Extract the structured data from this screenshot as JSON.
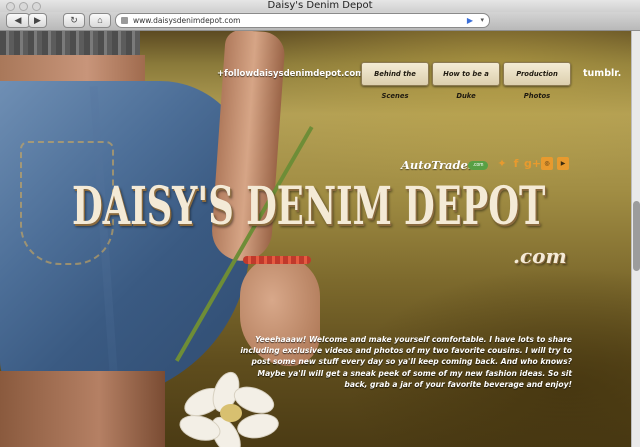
{
  "window": {
    "title": "Daisy's Denim Depot"
  },
  "toolbar": {
    "back_label": "◀",
    "forward_label": "▶",
    "reload_label": "↻",
    "home_label": "⌂",
    "address_value": "www.daisysdenimdepot.com",
    "go_label": "▶",
    "dropdown_label": "▾"
  },
  "nav": {
    "follow_link": "+followdaisysdenimdepot.com",
    "buttons": [
      "Behind the Scenes",
      "How to be a Duke",
      "Production Photos"
    ],
    "tumblr": "tumblr."
  },
  "sponsor": {
    "name": "AutoTrader",
    "badge": ".com"
  },
  "social_icons": [
    "twitter-icon",
    "facebook-icon",
    "google-plus-icon",
    "instagram-icon",
    "youtube-icon"
  ],
  "logo": {
    "main": "DAISY'S DENIM DEPOT",
    "suffix": ".com"
  },
  "intro": {
    "lead": "Yeeehaaaw!",
    "body": " Welcome and make yourself comfortable. I have lots to share including exclusive videos and photos of my two favorite cousins. I will try to post some new stuff every day so ya'll keep coming back. And who knows? Maybe ya'll will get a sneak peek of some of my new fashion ideas. So sit back, grab a jar of your favorite beverage and enjoy!"
  },
  "colors": {
    "accent": "#e89a2e",
    "logo": "#f4ead6",
    "button_bg": "#e8dcc0"
  }
}
